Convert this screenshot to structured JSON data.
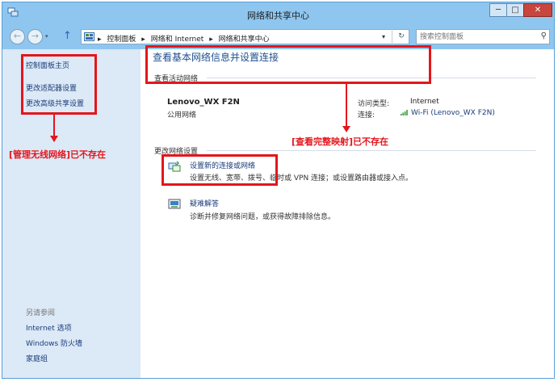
{
  "window": {
    "title": "网络和共享中心",
    "controls": {
      "minimize": "─",
      "maximize": "□",
      "close": "✕"
    }
  },
  "nav": {
    "breadcrumbs": [
      "控制面板",
      "网络和 Internet",
      "网络和共享中心"
    ],
    "separator": "▸",
    "search_placeholder": "搜索控制面板"
  },
  "sidebar": {
    "links": [
      "控制面板主页",
      "更改适配器设置",
      "更改高级共享设置"
    ],
    "see_also_heading": "另请参阅",
    "see_also": [
      "Internet 选项",
      "Windows 防火墙",
      "家庭组"
    ]
  },
  "main": {
    "heading": "查看基本网络信息并设置连接",
    "active_networks_label": "查看活动网络",
    "network": {
      "name": "Lenovo_WX F2N",
      "type": "公用网络",
      "access_type_label": "访问类型:",
      "access_type_value": "Internet",
      "connection_label": "连接:",
      "connection_value": "Wi-Fi (Lenovo_WX F2N)"
    },
    "change_settings_label": "更改网络设置",
    "tasks": [
      {
        "title": "设置新的连接或网络",
        "desc": "设置无线、宽带、拨号、临时或 VPN 连接；或设置路由器或接入点。"
      },
      {
        "title": "疑难解答",
        "desc": "诊断并修复网络问题，或获得故障排除信息。"
      }
    ]
  },
  "annotations": {
    "wireless": "[管理无线网络]已不存在",
    "map": "[查看完整映射]已不存在"
  },
  "colors": {
    "annotation": "#e3161c",
    "link": "#1a3c7a",
    "heading": "#1e4f8f",
    "chrome": "#8ec6ef",
    "sidebar": "#dce9f6"
  }
}
